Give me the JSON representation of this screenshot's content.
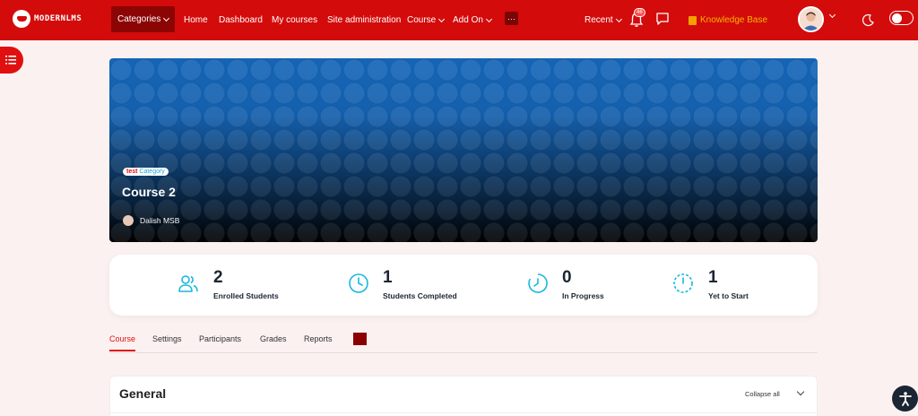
{
  "brand": {
    "name": "MODERNLMS"
  },
  "nav": {
    "categories": "Categories",
    "home": "Home",
    "dashboard": "Dashboard",
    "my_courses": "My courses",
    "site_admin": "Site administration",
    "course": "Course",
    "add_on": "Add On",
    "more": "···",
    "recent": "Recent",
    "notification_count": "46",
    "knowledge_base": "Knowledge Base"
  },
  "header": {
    "category_prefix": "test",
    "category_name": "Category",
    "course_title": "Course 2",
    "teacher": "Dalish MSB"
  },
  "stats": [
    {
      "value": "2",
      "label": "Enrolled Students",
      "icon": "users-icon"
    },
    {
      "value": "1",
      "label": "Students Completed",
      "icon": "clock-icon"
    },
    {
      "value": "0",
      "label": "In Progress",
      "icon": "progress-clock-icon"
    },
    {
      "value": "1",
      "label": "Yet to Start",
      "icon": "timer-icon"
    }
  ],
  "tabs": [
    {
      "label": "Course",
      "active": true
    },
    {
      "label": "Settings"
    },
    {
      "label": "Participants"
    },
    {
      "label": "Grades"
    },
    {
      "label": "Reports"
    }
  ],
  "section": {
    "title": "General",
    "collapse_label": "Collapse all"
  },
  "colors": {
    "primary": "#d40b0b",
    "accent_cyan": "#18b8e0",
    "banner": "#1565b7"
  }
}
